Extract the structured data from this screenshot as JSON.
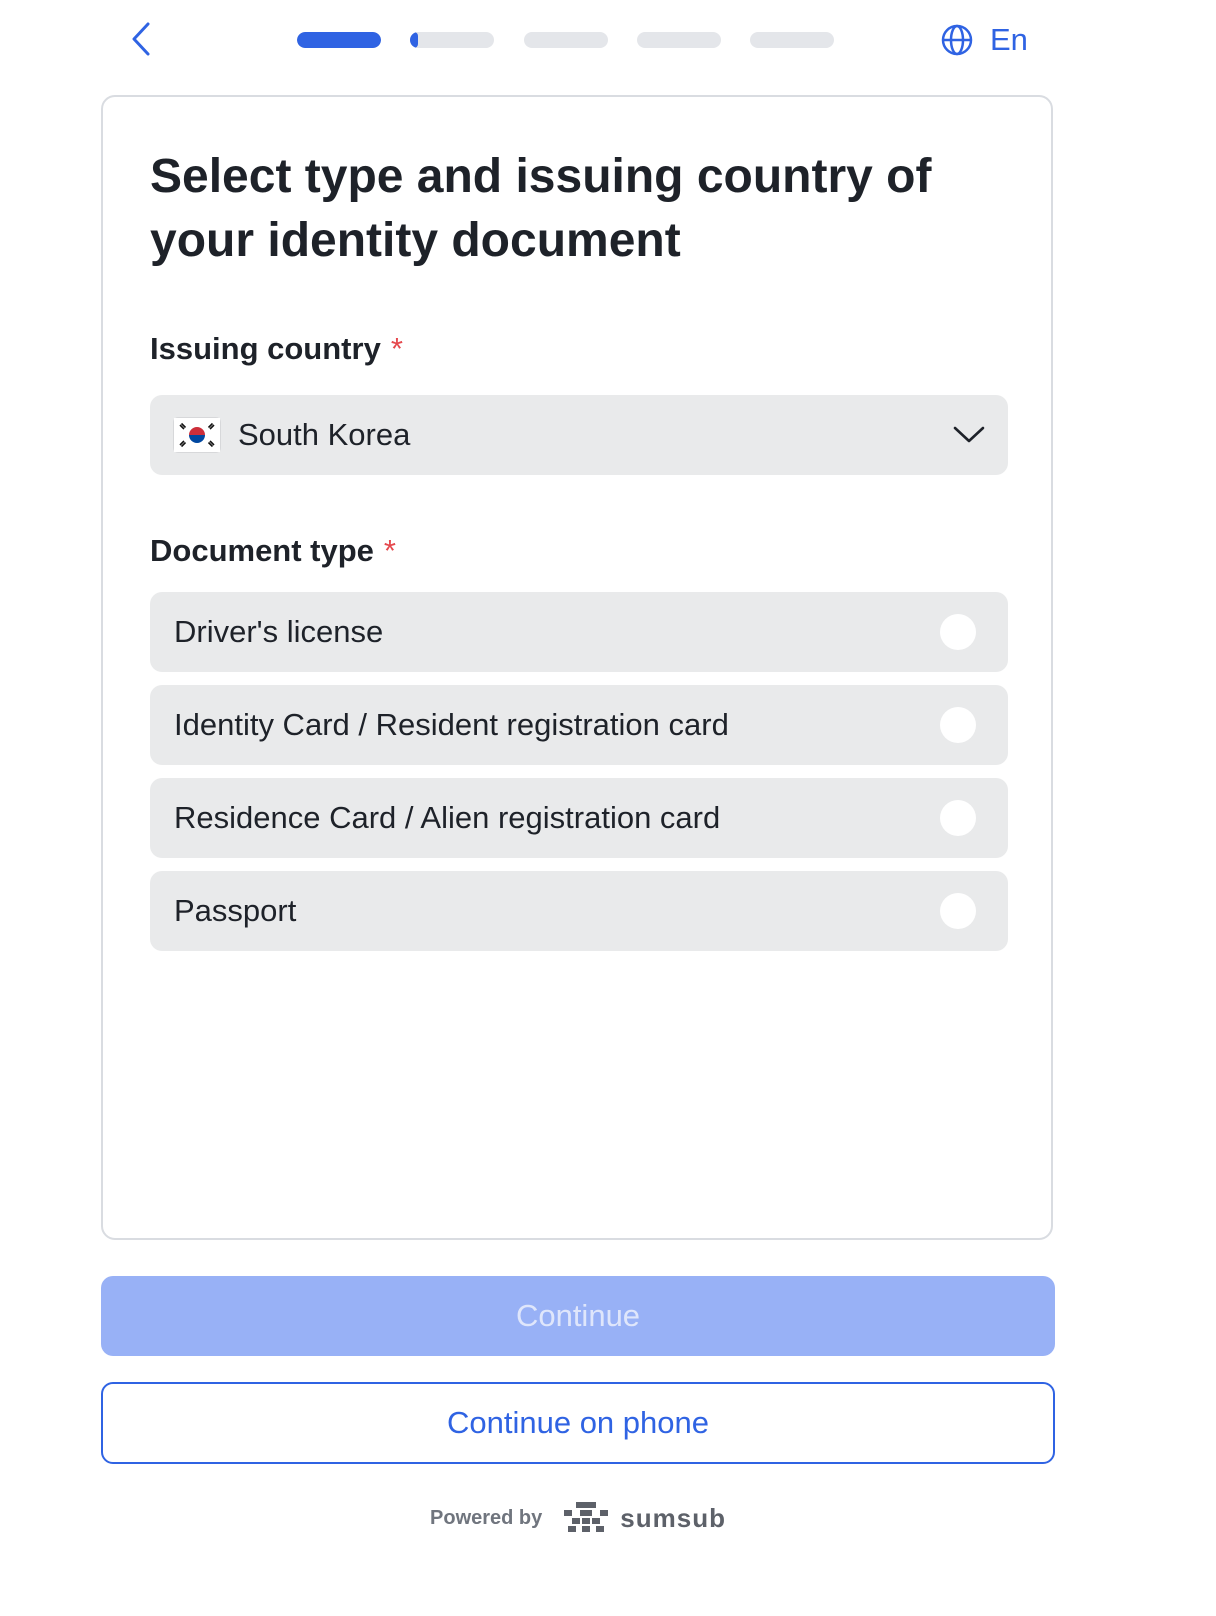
{
  "header": {
    "back_icon": "chevron-left-icon",
    "progress": [
      1,
      0.1,
      0,
      0,
      0
    ],
    "language_icon": "globe-icon",
    "language": "En"
  },
  "card": {
    "title": "Select type and issuing country of your identity document",
    "country_label": "Issuing country",
    "required_mark": "*",
    "country_value": "South Korea",
    "country_flag": "south-korea-flag-icon",
    "document_type_label": "Document type",
    "document_types": [
      {
        "label": "Driver's license",
        "selected": false
      },
      {
        "label": "Identity Card / Resident registration card",
        "selected": false
      },
      {
        "label": "Residence Card / Alien registration card",
        "selected": false
      },
      {
        "label": "Passport",
        "selected": false
      }
    ]
  },
  "actions": {
    "continue_label": "Continue",
    "continue_enabled": false,
    "continue_on_phone_label": "Continue on phone"
  },
  "footer": {
    "powered_by": "Powered by",
    "brand": "sumsub"
  },
  "colors": {
    "accent": "#2f63e3",
    "disabled_button": "#98b1f6",
    "option_background": "#e9eaeb",
    "required": "#e5484d"
  }
}
